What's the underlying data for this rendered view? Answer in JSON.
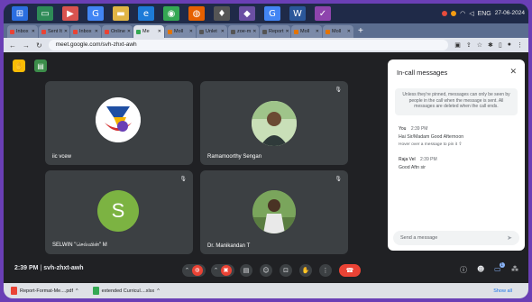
{
  "taskbar": {
    "icons": [
      "windows-icon",
      "monitor-icon",
      "media-icon",
      "chrome-icon",
      "folder-icon",
      "edge-icon",
      "chrome-icon",
      "firefox-icon",
      "app-icon",
      "app-icon",
      "chrome-icon",
      "word-icon",
      "app-icon"
    ],
    "tray_lang": "ENG",
    "tray_date": "27-06-2024"
  },
  "browser": {
    "tabs": [
      {
        "label": "Inbox",
        "color": "#ea4335"
      },
      {
        "label": "Sent It",
        "color": "#ea4335"
      },
      {
        "label": "Inbox",
        "color": "#ea4335"
      },
      {
        "label": "Online",
        "color": "#ea4335"
      },
      {
        "label": "Me",
        "color": "#34a853"
      },
      {
        "label": "Moll ",
        "color": "#e37400"
      },
      {
        "label": "Unlet",
        "color": "#555555"
      },
      {
        "label": "zoe-m",
        "color": "#555555"
      },
      {
        "label": "Report",
        "color": "#555555"
      },
      {
        "label": "Moll ",
        "color": "#e37400"
      },
      {
        "label": "Moll ",
        "color": "#e37400"
      }
    ],
    "url": "meet.google.com/svh-zhxt-awh"
  },
  "meet": {
    "participants": [
      {
        "name": "iic vcew"
      },
      {
        "name": "Ramamoorthy Sengan"
      },
      {
        "name": "SELWIN \"செல்வின்\" M",
        "initial": "S"
      },
      {
        "name": "Dr. Manikandan T"
      }
    ],
    "chat": {
      "title": "In-call messages",
      "notice": "Unless they're pinned, messages can only be seen by people in the call when the message is sent. All messages are deleted when the call ends.",
      "messages": [
        {
          "sender": "You",
          "time": "2:39 PM",
          "text": "Hai Sir/Madam Good Afternoon",
          "hint": "Hover over a message to pin it"
        },
        {
          "sender": "Raja Vel",
          "time": "2:39 PM",
          "text": "Good Aftn sir",
          "hint": ""
        }
      ],
      "input_placeholder": "Send a message"
    },
    "time": "2:39 PM",
    "meeting_code": "svh-zhxt-awh",
    "chat_badge": "1"
  },
  "downloads": {
    "items": [
      {
        "name": "Report-Format-Me....pdf",
        "color": "#ea4335"
      },
      {
        "name": "extended Curricul....xlsx",
        "color": "#34a853"
      }
    ],
    "show_all": "Show all"
  }
}
